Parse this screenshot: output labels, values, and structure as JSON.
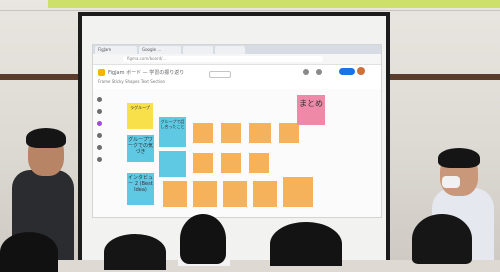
{
  "browser": {
    "tabs": [
      "FigJam",
      "Google ...",
      "",
      ""
    ],
    "url": "figma.com/board/...",
    "doc_title": "FigJam ボード — 学習の振り返り",
    "toolbar_frame": "Frame  Sticky  Shapes  Text  Section"
  },
  "board": {
    "summary_note": "まとめ",
    "yellow_note": "ラグループ",
    "cyan_notes": [
      "グループワークでの気づき",
      "グループで話し合ったこと",
      "インタビュー 2 (Best Idea)"
    ],
    "orange_notes": [
      "",
      "",
      "",
      "",
      "",
      "",
      "",
      "",
      "",
      "",
      "",
      ""
    ]
  },
  "colors": {
    "yellow": "#f7e04a",
    "cyan": "#5fc9e4",
    "orange": "#f6b25a",
    "pink": "#ee8aa8",
    "banner": "#cde06a"
  }
}
